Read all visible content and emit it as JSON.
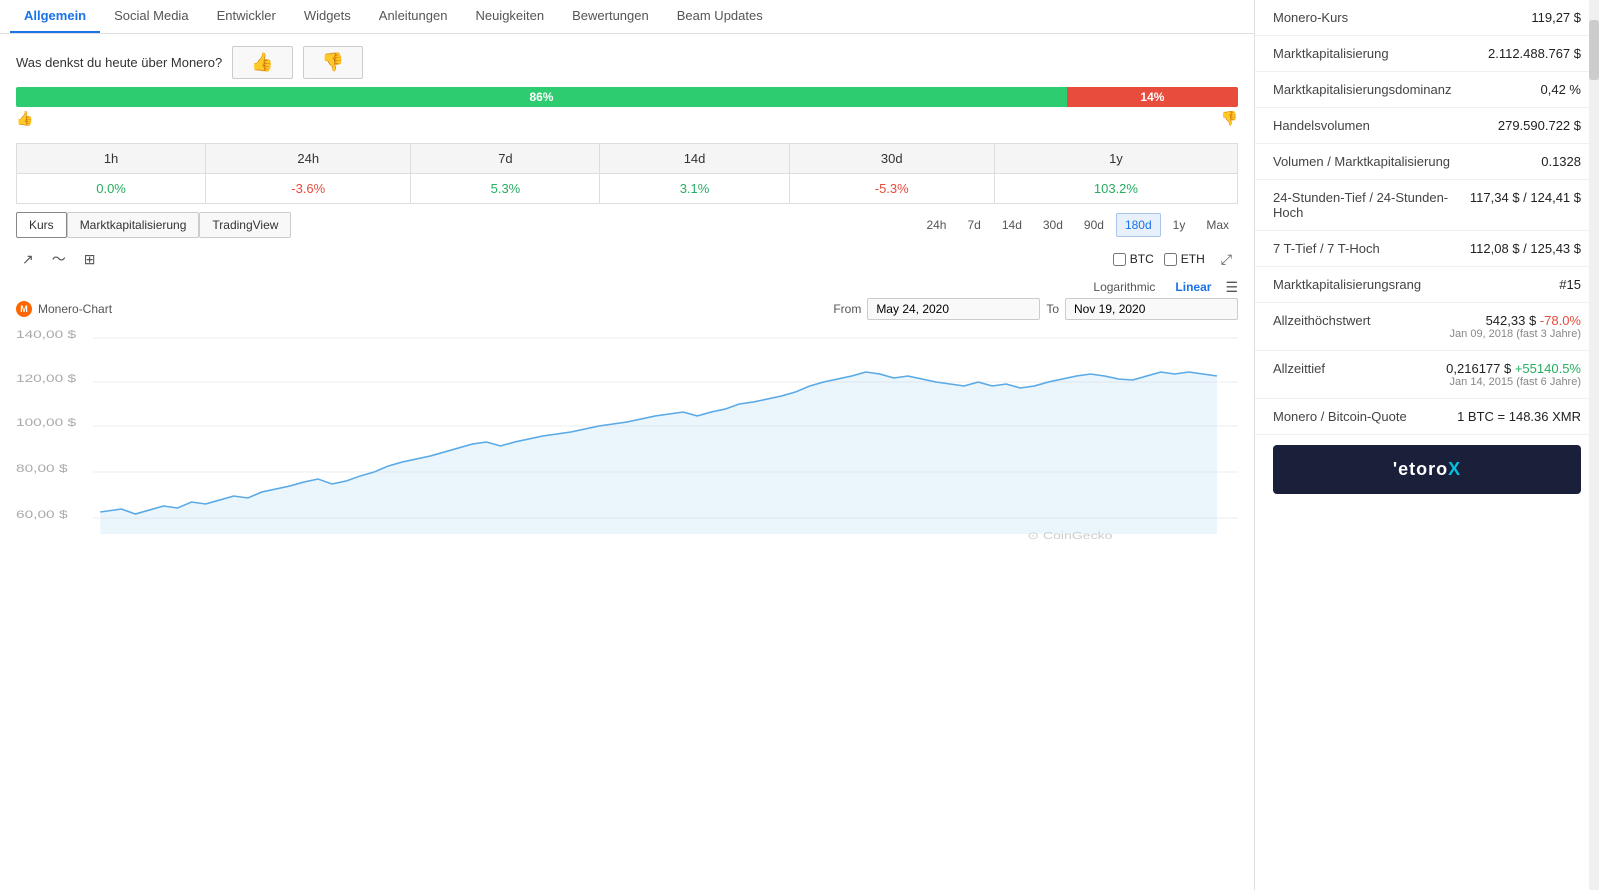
{
  "nav": {
    "items": [
      {
        "label": "Allgemein",
        "active": true
      },
      {
        "label": "Social Media",
        "active": false
      },
      {
        "label": "Entwickler",
        "active": false
      },
      {
        "label": "Widgets",
        "active": false
      },
      {
        "label": "Anleitungen",
        "active": false
      },
      {
        "label": "Neuigkeiten",
        "active": false
      },
      {
        "label": "Bewertungen",
        "active": false
      },
      {
        "label": "Beam Updates",
        "active": false
      }
    ]
  },
  "sentiment": {
    "question": "Was denkst du heute über Monero?",
    "thumbs_up": "👍",
    "thumbs_down": "👎",
    "green_pct": 86,
    "red_pct": 14,
    "green_label": "86%",
    "red_label": "14%"
  },
  "periods": {
    "headers": [
      "1h",
      "24h",
      "7d",
      "14d",
      "30d",
      "1y"
    ],
    "values": [
      "0.0%",
      "-3.6%",
      "5.3%",
      "3.1%",
      "-5.3%",
      "103.2%"
    ],
    "classes": [
      "positive",
      "negative",
      "positive",
      "positive",
      "negative",
      "positive"
    ]
  },
  "chart_tabs": [
    {
      "label": "Kurs",
      "active": true
    },
    {
      "label": "Marktkapitalisierung",
      "active": false
    },
    {
      "label": "TradingView",
      "active": false
    }
  ],
  "time_buttons": [
    {
      "label": "24h",
      "active": false
    },
    {
      "label": "7d",
      "active": false
    },
    {
      "label": "14d",
      "active": false
    },
    {
      "label": "30d",
      "active": false
    },
    {
      "label": "90d",
      "active": false
    },
    {
      "label": "180d",
      "active": true
    },
    {
      "label": "1y",
      "active": false
    },
    {
      "label": "Max",
      "active": false
    }
  ],
  "chart_icons": {
    "line1": "↗",
    "line2": "〜",
    "candle": "⊞"
  },
  "checkboxes": {
    "btc_label": "BTC",
    "eth_label": "ETH"
  },
  "scale": {
    "logarithmic": "Logarithmic",
    "linear": "Linear"
  },
  "chart": {
    "coin_name": "Monero-Chart",
    "from_label": "From",
    "to_label": "To",
    "from_date": "May 24, 2020",
    "to_date": "Nov 19, 2020",
    "y_labels": [
      "140,00 $",
      "120,00 $",
      "100,00 $",
      "80,00 $",
      "60,00 $"
    ]
  },
  "stats": [
    {
      "label": "Monero-Kurs",
      "value": "119,27 $",
      "sub": null,
      "value_class": ""
    },
    {
      "label": "Marktkapitalisierung",
      "value": "2.112.488.767 $",
      "sub": null,
      "value_class": ""
    },
    {
      "label": "Marktkapitalisierungsdominanz",
      "value": "0,42 %",
      "sub": null,
      "value_class": ""
    },
    {
      "label": "Handelsvolumen",
      "value": "279.590.722 $",
      "sub": null,
      "value_class": ""
    },
    {
      "label": "Volumen / Marktkapitalisierung",
      "value": "0.1328",
      "sub": null,
      "value_class": ""
    },
    {
      "label": "24-Stunden-Tief / 24-Stunden-Hoch",
      "value": "117,34 $ / 124,41 $",
      "sub": null,
      "value_class": ""
    },
    {
      "label": "7 T-Tief / 7 T-Hoch",
      "value": "112,08 $ / 125,43 $",
      "sub": null,
      "value_class": ""
    },
    {
      "label": "Marktkapitalisierungsrang",
      "value": "#15",
      "sub": null,
      "value_class": ""
    },
    {
      "label": "Allzeithöchstwert",
      "value": "542,33 $",
      "value_extra": "-78.0%",
      "value_extra_class": "negative",
      "sub": "Jan 09, 2018 (fast 3 Jahre)"
    },
    {
      "label": "Allzeittief",
      "value": "0,216177 $",
      "value_extra": "+55140.5%",
      "value_extra_class": "positive",
      "sub": "Jan 14, 2015 (fast 6 Jahre)"
    },
    {
      "label": "Monero / Bitcoin-Quote",
      "value": "1 BTC = 148.36 XMR",
      "sub": null,
      "value_class": ""
    }
  ],
  "ad": {
    "text1": "'etoro",
    "text2": "X"
  }
}
